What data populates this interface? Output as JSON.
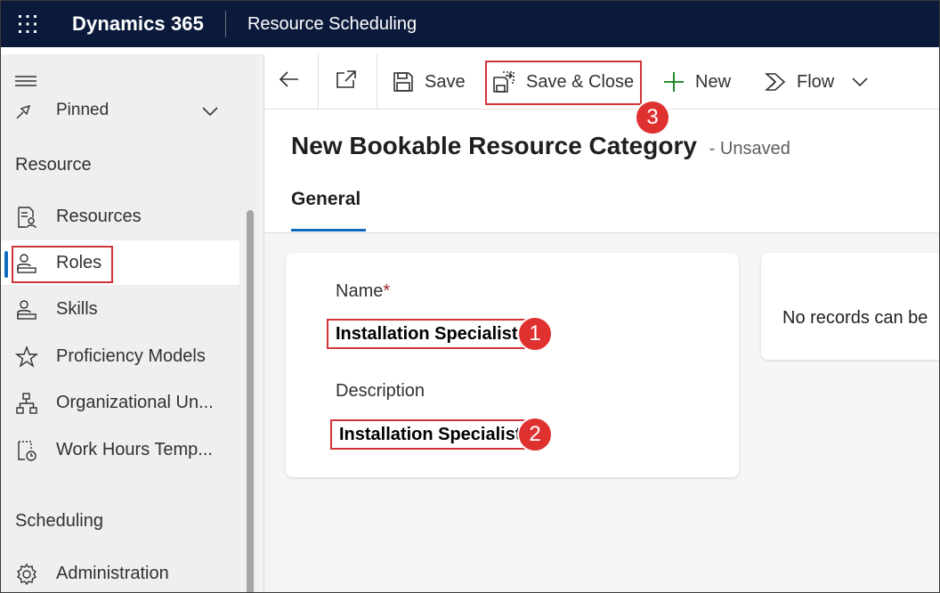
{
  "topbar": {
    "app_name": "Dynamics 365",
    "area_name": "Resource Scheduling"
  },
  "sidebar": {
    "pinned_label": "Pinned",
    "section_resource": "Resource",
    "section_scheduling": "Scheduling",
    "items": [
      {
        "label": "Resources",
        "icon": "resources-icon"
      },
      {
        "label": "Roles",
        "icon": "roles-icon",
        "selected": true
      },
      {
        "label": "Skills",
        "icon": "skills-icon"
      },
      {
        "label": "Proficiency Models",
        "icon": "star-icon"
      },
      {
        "label": "Organizational Un...",
        "icon": "org-chart-icon"
      },
      {
        "label": "Work Hours Temp...",
        "icon": "calendar-clock-icon"
      }
    ],
    "administration_label": "Administration"
  },
  "commandbar": {
    "save_label": "Save",
    "save_close_label": "Save & Close",
    "new_label": "New",
    "flow_label": "Flow"
  },
  "form": {
    "title": "New Bookable Resource Category",
    "status": "- Unsaved",
    "tab_general": "General",
    "name_label": "Name",
    "required_mark": "*",
    "name_value": "Installation Specialist",
    "description_label": "Description",
    "description_value": "Installation Specialist",
    "no_records_text": "No records can be"
  },
  "callouts": {
    "one": "1",
    "two": "2",
    "three": "3"
  },
  "colors": {
    "topbar_bg": "#0b1a3a",
    "accent_blue": "#0f6cbd",
    "highlight_red": "#d13438",
    "new_plus_green": "#107c10"
  }
}
